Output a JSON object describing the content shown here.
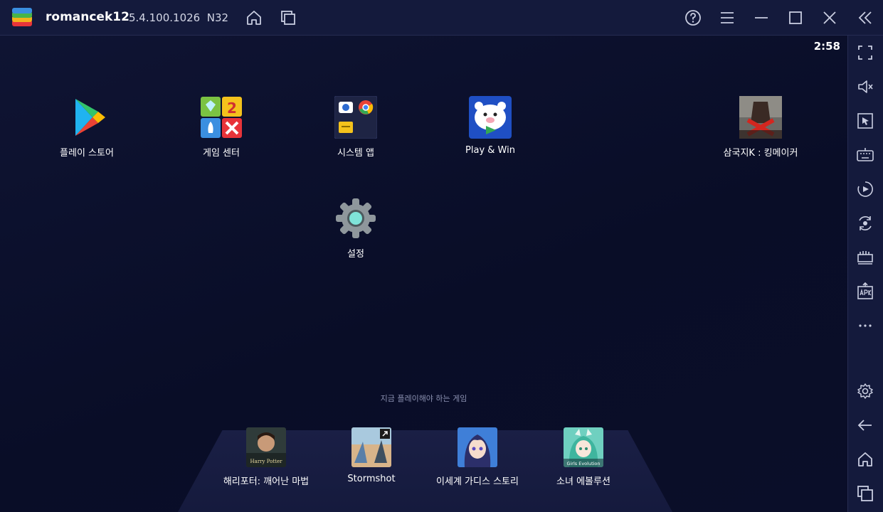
{
  "titlebar": {
    "app_name": "romancek12",
    "version": "5.4.100.1026",
    "build": "N32",
    "icons": [
      "bluestacks-logo",
      "home-icon",
      "multi-instance-icon",
      "help-icon",
      "menu-icon",
      "minimize-icon",
      "maximize-icon",
      "close-icon",
      "collapse-sidebar-icon"
    ]
  },
  "screen": {
    "clock": "2:58",
    "apps": [
      {
        "label": "플레이 스토어",
        "icon": "play-store-icon"
      },
      {
        "label": "게임 센터",
        "icon": "game-center-icon"
      },
      {
        "label": "시스템 앱",
        "icon": "system-apps-icon"
      },
      {
        "label": "Play & Win",
        "icon": "play-and-win-icon"
      },
      {
        "label": "삼국지K : 킹메이커",
        "icon": "kingmaker-game-icon"
      },
      {
        "label": "설정",
        "icon": "settings-icon"
      }
    ],
    "recent_title": "지금 플레이해야 하는 게임",
    "recent": [
      {
        "label": "해리포터: 깨어난 마법",
        "icon": "harry-potter-game-icon",
        "icon_text": "Harry Potter"
      },
      {
        "label": "Stormshot",
        "icon": "stormshot-game-icon"
      },
      {
        "label": "이세계 가디스 스토리",
        "icon": "goddess-story-game-icon"
      },
      {
        "label": "소녀 에볼루션",
        "icon": "girls-evolution-game-icon",
        "icon_text": "Girls Evolution"
      }
    ]
  },
  "sidebar": {
    "icons": [
      "fullscreen-icon",
      "volume-icon",
      "pointer-icon",
      "keyboard-icon",
      "record-icon",
      "rotate-icon",
      "macro-icon",
      "apk-icon",
      "more-icon",
      "settings-icon",
      "back-icon",
      "home-icon",
      "recent-apps-icon"
    ]
  },
  "colors": {
    "background": "#0b0f2b",
    "chrome": "#141a3c",
    "text": "#ffffff",
    "muted": "#8a90b0"
  }
}
